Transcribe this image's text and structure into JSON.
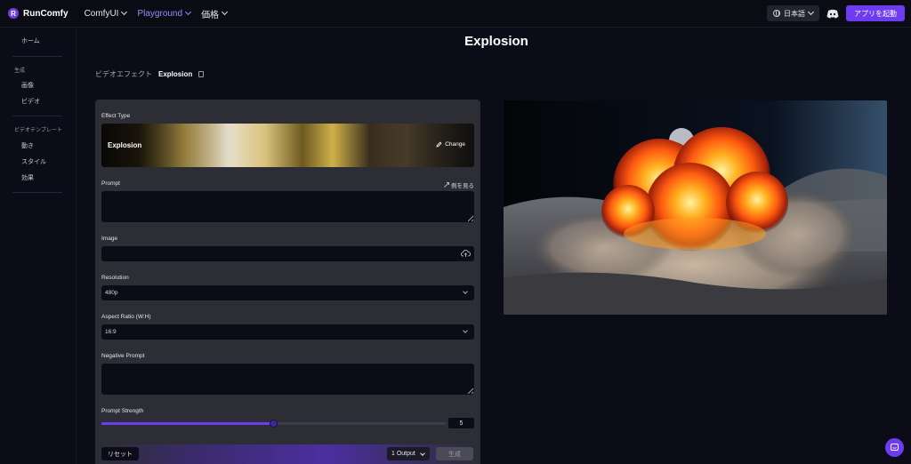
{
  "header": {
    "logo_mark": "R",
    "logo_text": "RunComfy",
    "nav": [
      {
        "label": "ComfyUI"
      },
      {
        "label": "Playground"
      },
      {
        "label": "価格"
      }
    ],
    "language": "日本語",
    "launch_label": "アプリを起動",
    "accent_color": "#6e3cf0"
  },
  "sidebar": {
    "home": "ホーム",
    "section_generate": "生成",
    "items_generate": [
      "画像",
      "ビデオ"
    ],
    "section_templates": "ビデオテンプレート",
    "items_templates": [
      "動き",
      "スタイル",
      "効果"
    ]
  },
  "main": {
    "title": "Explosion",
    "breadcrumb": {
      "parent": "ビデオエフェクト",
      "current": "Explosion"
    }
  },
  "form": {
    "effect_type_label": "Effect Type",
    "effect_name": "Explosion",
    "change_label": "Change",
    "prompt_label": "Prompt",
    "prompt_value": "",
    "example_link": "例を見る",
    "image_label": "Image",
    "resolution_label": "Resolution",
    "resolution_value": "480p",
    "aspect_label": "Aspect Ratio (W:H)",
    "aspect_value": "16:9",
    "negative_label": "Negative Prompt",
    "negative_value": "",
    "strength_label": "Prompt Strength",
    "strength_value": "5",
    "strength_fraction": 0.5
  },
  "footer": {
    "reset_label": "リセット",
    "output_label": "1 Output",
    "generate_label": "生成"
  },
  "icons": [
    "globe-icon",
    "discord-icon",
    "chevron-down-icon",
    "pencil-icon",
    "expand-icon",
    "upload-cloud-icon",
    "chat-icon",
    "document-icon"
  ]
}
